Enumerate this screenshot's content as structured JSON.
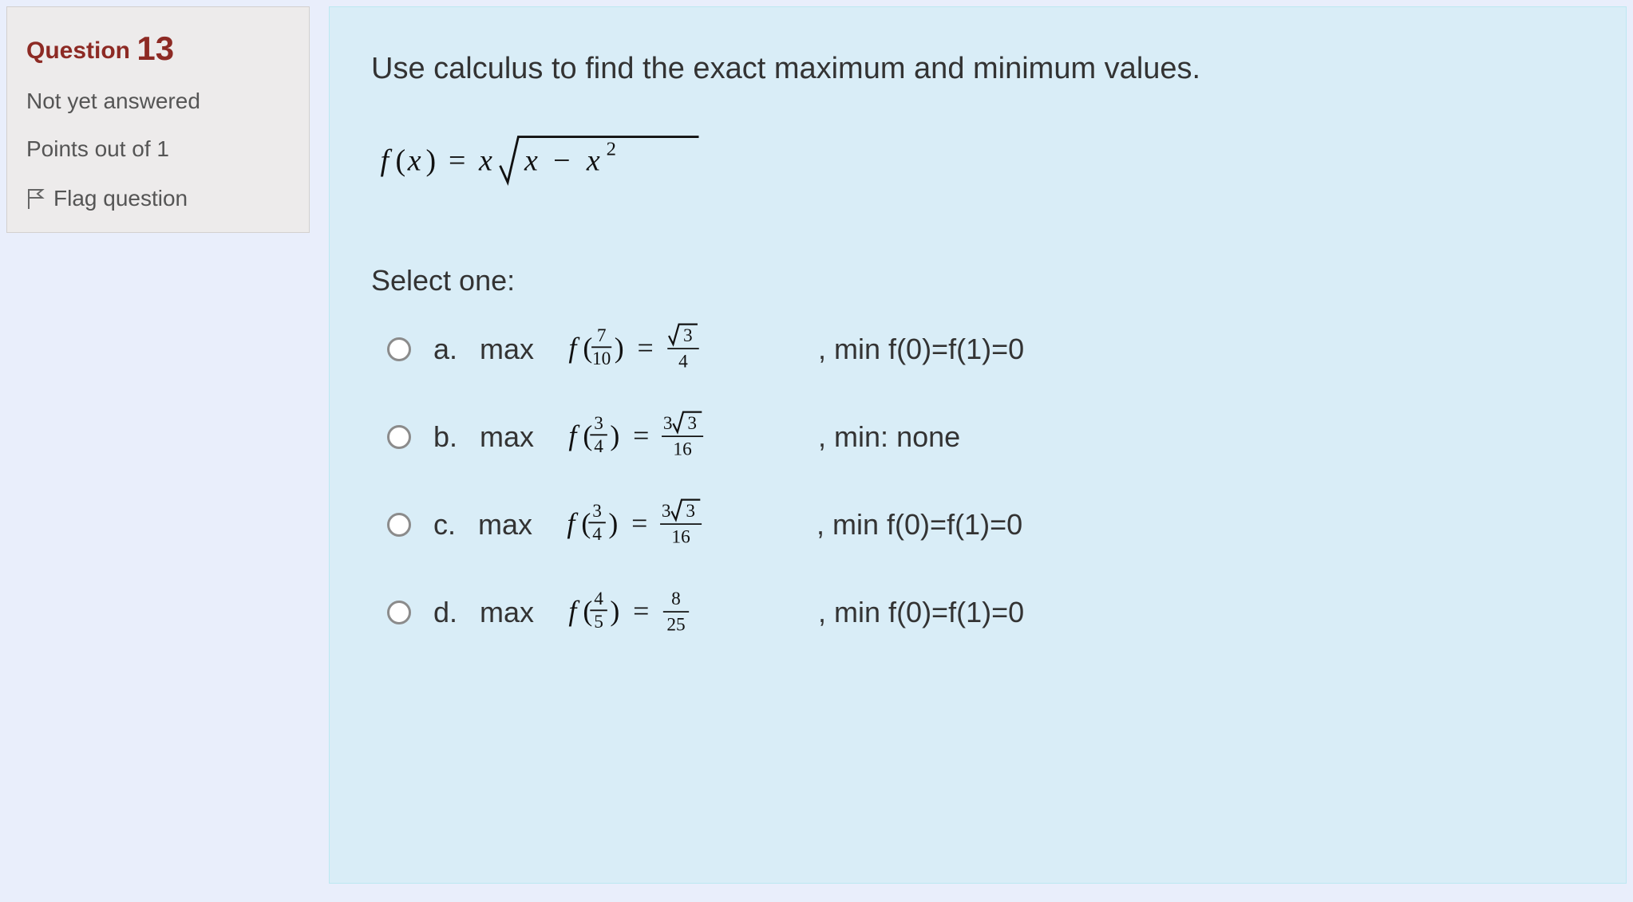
{
  "info": {
    "question_label": "Question",
    "question_number": "13",
    "status": "Not yet answered",
    "points": "Points out of 1",
    "flag_label": "Flag question"
  },
  "question": {
    "prompt": "Use calculus to find the exact maximum and minimum values.",
    "formula_plain": "f(x) = x √(x − x²)",
    "select_label": "Select one:",
    "options": [
      {
        "letter": "a.",
        "prefix": "max",
        "math_plain": "f(7/10) = √3 / 4",
        "tail": ", min f(0)=f(1)=0"
      },
      {
        "letter": "b.",
        "prefix": "max",
        "math_plain": "f(3/4) = 3√3 / 16",
        "tail": ", min: none"
      },
      {
        "letter": "c.",
        "prefix": "max",
        "math_plain": "f(3/4) = 3√3 / 16",
        "tail": ", min f(0)=f(1)=0"
      },
      {
        "letter": "d.",
        "prefix": "max",
        "math_plain": "f(4/5) = 8 / 25",
        "tail": ", min f(0)=f(1)=0"
      }
    ]
  }
}
